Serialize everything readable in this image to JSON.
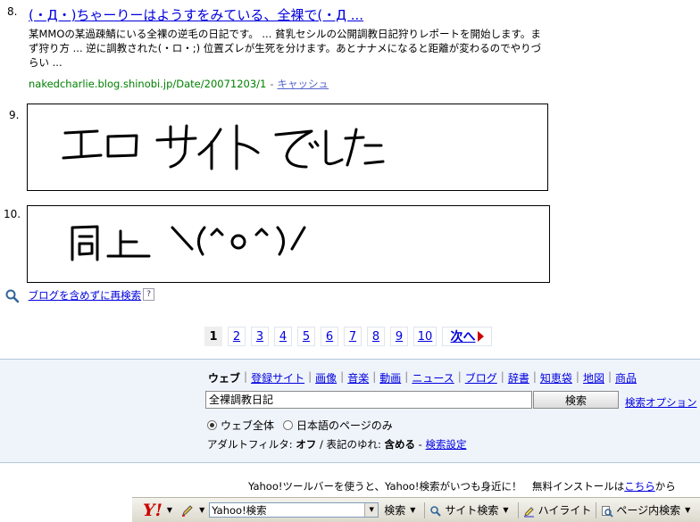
{
  "result8": {
    "num": "8.",
    "title": "(・Д・)ちゃーりーはようすをみている、全裸で(・Д ...",
    "snippet": "某MMOの某過疎鯖にいる全裸の逆毛の日記です。 ... 貧乳セシルの公開調教日記狩りレポートを開始します。まず狩り方 ... 逆に調教された(・ロ・;) 位置ズレが生死を分けます。あとナナメになると距離が変わるのでやりづらい ...",
    "url": "nakedcharlie.blog.shinobi.jp/Date/20071203/1",
    "url_sep": "-",
    "cache": "キャッシュ"
  },
  "result9": {
    "num": "9.",
    "handwriting": "エロ サイト でした"
  },
  "result10": {
    "num": "10.",
    "handwriting": "同上 \\(^o^)/"
  },
  "research": {
    "label": "ブログを含めずに再検索",
    "help": "?"
  },
  "pager": {
    "pages": [
      "1",
      "2",
      "3",
      "4",
      "5",
      "6",
      "7",
      "8",
      "9",
      "10"
    ],
    "current": "1",
    "next": "次へ"
  },
  "search_panel": {
    "tabs": [
      "ウェブ",
      "登録サイト",
      "画像",
      "音楽",
      "動画",
      "ニュース",
      "ブログ",
      "辞書",
      "知恵袋",
      "地図",
      "商品"
    ],
    "current_tab": "ウェブ",
    "query": "全裸調教日記",
    "search_button": "検索",
    "options_link": "検索オプション",
    "radio_all": "ウェブ全体",
    "radio_ja": "日本語のページのみ",
    "filter_label": "アダルトフィルタ: ",
    "filter_value": "オフ",
    "variant_label": " / 表記のゆれ: ",
    "variant_value": "含める",
    "settings_sep": " - ",
    "settings_link": "検索設定"
  },
  "promo": {
    "text": "Yahoo!ツールバーを使うと、Yahoo!検索がいつも身近に！　無料インストールは",
    "link": "こちら",
    "suffix": "から"
  },
  "toolbar": {
    "logo": "Y!",
    "input": "Yahoo!検索",
    "search": "検索",
    "site_search": "サイト検索",
    "highlight": "ハイライト",
    "page_search": "ページ内検索"
  }
}
